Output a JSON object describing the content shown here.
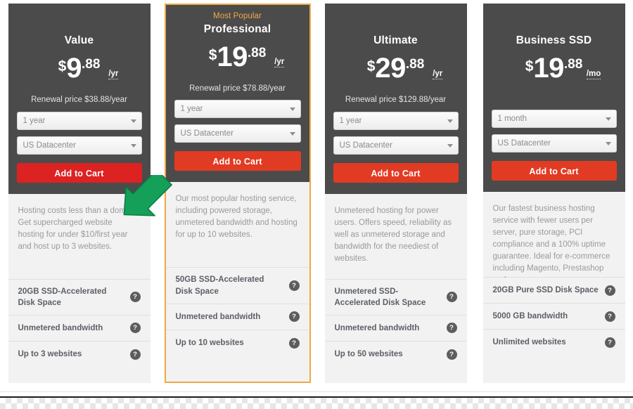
{
  "theme": {
    "card_bg_dark": "#4b4b4b",
    "card_bg_light": "#f2f2f2",
    "accent_orange": "#f0a845",
    "cta_red": "#e23b23",
    "text_muted": "#9a9a9a",
    "feature_text": "#5c5f66"
  },
  "help_icon_glyph": "?",
  "plans": [
    {
      "badge": "",
      "name": "Value",
      "currency": "$",
      "amount": "9",
      "cents": ".88",
      "period": "/yr",
      "renewal": "Renewal price $38.88/year",
      "term_select": "1 year",
      "datacenter_select": "US Datacenter",
      "cta_label": "Add to Cart",
      "description": "Hosting costs less than a domain! Get supercharged website hosting for under $10/first year and host up to 3 websites.",
      "features": [
        "20GB SSD-Accelerated Disk Space",
        "Unmetered bandwidth",
        "Up to 3 websites"
      ]
    },
    {
      "badge": "Most Popular",
      "name": "Professional",
      "currency": "$",
      "amount": "19",
      "cents": ".88",
      "period": "/yr",
      "renewal": "Renewal price $78.88/year",
      "term_select": "1 year",
      "datacenter_select": "US Datacenter",
      "cta_label": "Add to Cart",
      "description": "Our most popular hosting service, including powered storage, unmetered bandwidth and hosting for up to 10 websites.",
      "features": [
        "50GB SSD-Accelerated Disk Space",
        "Unmetered bandwidth",
        "Up to 10 websites"
      ]
    },
    {
      "badge": "",
      "name": "Ultimate",
      "currency": "$",
      "amount": "29",
      "cents": ".88",
      "period": "/yr",
      "renewal": "Renewal price $129.88/year",
      "term_select": "1 year",
      "datacenter_select": "US Datacenter",
      "cta_label": "Add to Cart",
      "description": "Unmetered hosting for power users. Offers speed, reliability as well as unmetered storage and bandwidth for the neediest of websites.",
      "features": [
        "Unmetered SSD-Accelerated Disk Space",
        "Unmetered bandwidth",
        "Up to 50 websites"
      ]
    },
    {
      "badge": "",
      "name": "Business SSD",
      "currency": "$",
      "amount": "19",
      "cents": ".88",
      "period": "/mo",
      "renewal": "",
      "term_select": "1 month",
      "datacenter_select": "US Datacenter",
      "cta_label": "Add to Cart",
      "description": "Our fastest business hosting service with fewer users per server, pure storage, PCI compliance and a 100% uptime guarantee. Ideal for e-commerce including Magento, Prestashop and more",
      "features": [
        "20GB Pure SSD Disk Space",
        "5000 GB bandwidth",
        "Unlimited websites"
      ]
    }
  ]
}
